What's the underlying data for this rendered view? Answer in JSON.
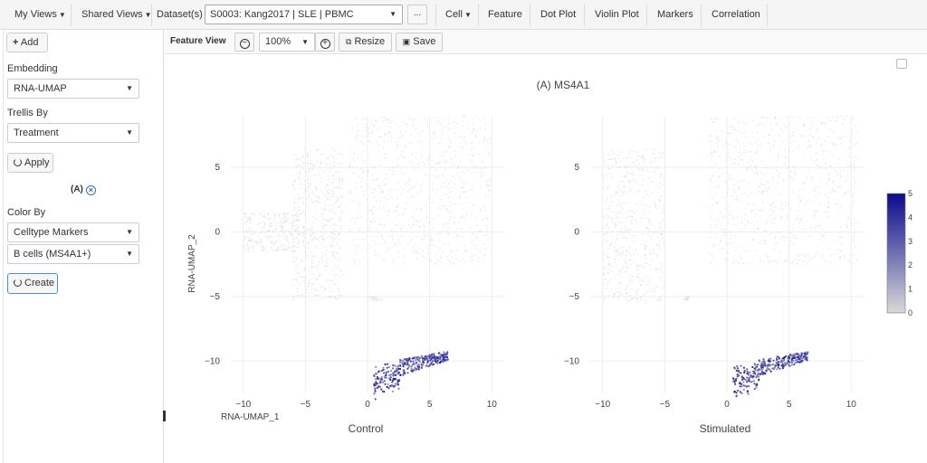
{
  "nav": {
    "my_views": "My Views",
    "shared_views": "Shared Views",
    "dataset_label": "Dataset(s)",
    "dataset_value": "S0003: Kang2017 | SLE | PBMC",
    "more": "...",
    "cell": "Cell",
    "feature": "Feature",
    "dot_plot": "Dot Plot",
    "violin_plot": "Violin Plot",
    "markers": "Markers",
    "correlation": "Correlation"
  },
  "sidebar": {
    "add": "Add",
    "embedding_label": "Embedding",
    "embedding_value": "RNA-UMAP",
    "trellis_label": "Trellis By",
    "trellis_value": "Treatment",
    "apply": "Apply",
    "trellis_tag": "(A)",
    "color_by_label": "Color By",
    "color_by_value": "Celltype Markers",
    "marker_value": "B cells (MS4A1+)",
    "create": "Create"
  },
  "toolbar": {
    "title": "Feature View",
    "zoom": "100%",
    "resize": "Resize",
    "save": "Save"
  },
  "colors": {
    "accent": "#3a6fb5",
    "low": "#d9d9d9",
    "high": "#0a0a8c"
  },
  "chart_data": {
    "type": "scatter",
    "title": "(A) MS4A1",
    "xlabel": "RNA-UMAP_1",
    "ylabel": "RNA-UMAP_2",
    "xlim": [
      -11,
      11
    ],
    "ylim": [
      -12.5,
      9
    ],
    "xticks": [
      -10,
      -5,
      0,
      5,
      10
    ],
    "yticks": [
      5,
      0,
      -5,
      -10
    ],
    "colorbar": {
      "min": 0,
      "max": 5,
      "ticks": [
        5,
        4,
        3,
        2,
        1,
        0
      ]
    },
    "panels": [
      {
        "name": "Control",
        "clusters": [
          {
            "expr": 0,
            "n": 520,
            "x": [
              -6,
              -2
            ],
            "y": [
              -5.3,
              6.5
            ]
          },
          {
            "expr": 0,
            "n": 260,
            "x": [
              -10,
              -5.5
            ],
            "y": [
              -1.5,
              1.5
            ]
          },
          {
            "expr": 0,
            "n": 700,
            "x": [
              -1.5,
              10
            ],
            "y": [
              -2.5,
              9
            ]
          },
          {
            "expr": 0,
            "n": 25,
            "x": [
              0,
              1.2
            ],
            "y": [
              -5.3,
              -5
            ]
          },
          {
            "expr": 4,
            "n": 320,
            "x": [
              0.5,
              6.5
            ],
            "y": [
              -12,
              -9.3
            ]
          }
        ]
      },
      {
        "name": "Stimulated",
        "clusters": [
          {
            "expr": 0,
            "n": 520,
            "x": [
              -10,
              -5
            ],
            "y": [
              -5.5,
              6.5
            ]
          },
          {
            "expr": 0,
            "n": 700,
            "x": [
              -1.5,
              10.5
            ],
            "y": [
              -2.5,
              9
            ]
          },
          {
            "expr": 0,
            "n": 15,
            "x": [
              -3.5,
              -3
            ],
            "y": [
              -5.3,
              -5
            ]
          },
          {
            "expr": 4,
            "n": 320,
            "x": [
              0.5,
              6.5
            ],
            "y": [
              -12,
              -9.3
            ]
          }
        ]
      }
    ]
  }
}
